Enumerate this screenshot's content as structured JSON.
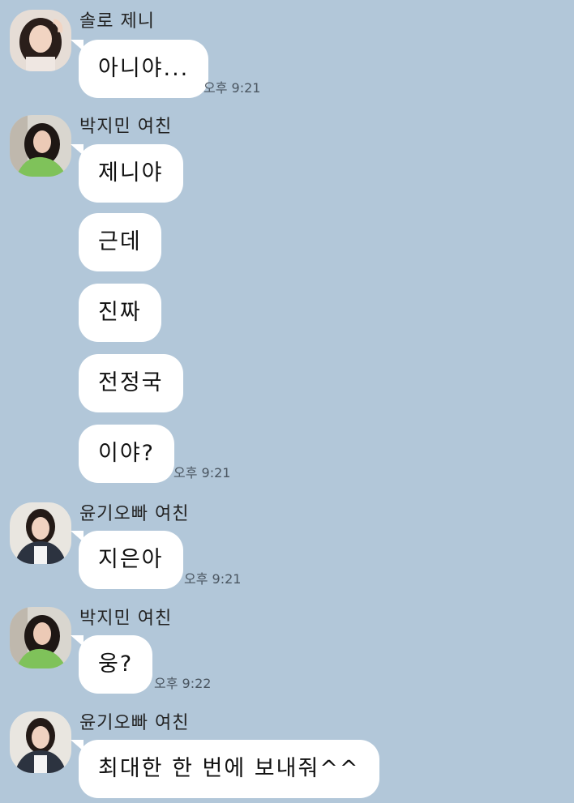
{
  "messages": [
    {
      "sender": "솔로 제니",
      "avatar": "avatar-solo-jennie",
      "bubbles": [
        "아니야..."
      ],
      "time": "오후 9:21"
    },
    {
      "sender": "박지민 여친",
      "avatar": "avatar-jimin-gf",
      "bubbles": [
        "제니야",
        "근데",
        "진짜",
        "전정국",
        "이야?"
      ],
      "time": "오후 9:21"
    },
    {
      "sender": "윤기오빠 여친",
      "avatar": "avatar-yoongi-gf",
      "bubbles": [
        "지은아"
      ],
      "time": "오후 9:21"
    },
    {
      "sender": "박지민 여친",
      "avatar": "avatar-jimin-gf",
      "bubbles": [
        "웅?"
      ],
      "time": "오후 9:22"
    },
    {
      "sender": "윤기오빠 여친",
      "avatar": "avatar-yoongi-gf",
      "bubbles": [
        "최대한 한 번에 보내줘^^"
      ],
      "time": ""
    }
  ],
  "colors": {
    "background": "#b2c7d9",
    "bubble": "#ffffff",
    "timestamp": "#4a5560"
  }
}
